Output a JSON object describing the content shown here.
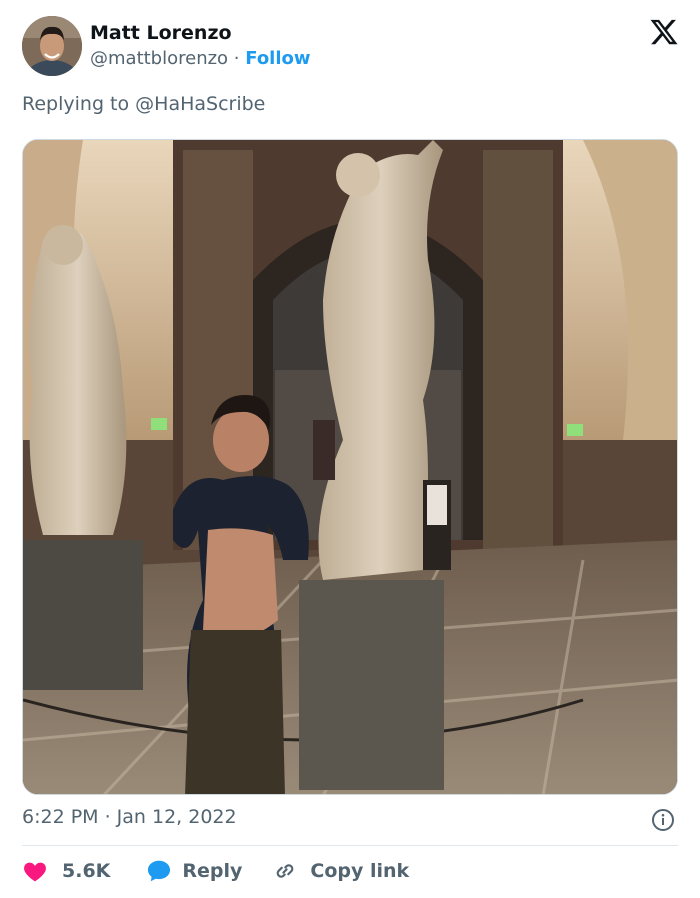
{
  "author": {
    "name": "Matt Lorenzo",
    "handle": "@mattblorenzo",
    "separator": " · ",
    "follow_label": "Follow"
  },
  "reply_context": "Replying to @HaHaScribe",
  "timestamp": "6:22 PM · Jan 12, 2022",
  "actions": {
    "likes": "5.6K",
    "reply_label": "Reply",
    "copy_label": "Copy link"
  },
  "icons": {
    "logo": "x-logo-icon",
    "info": "info-icon",
    "like": "heart-icon",
    "reply": "speech-bubble-icon",
    "copy": "link-icon"
  },
  "colors": {
    "accent": "#1d9bf0",
    "like": "#f91880",
    "muted": "#536471",
    "text": "#0f1419"
  }
}
